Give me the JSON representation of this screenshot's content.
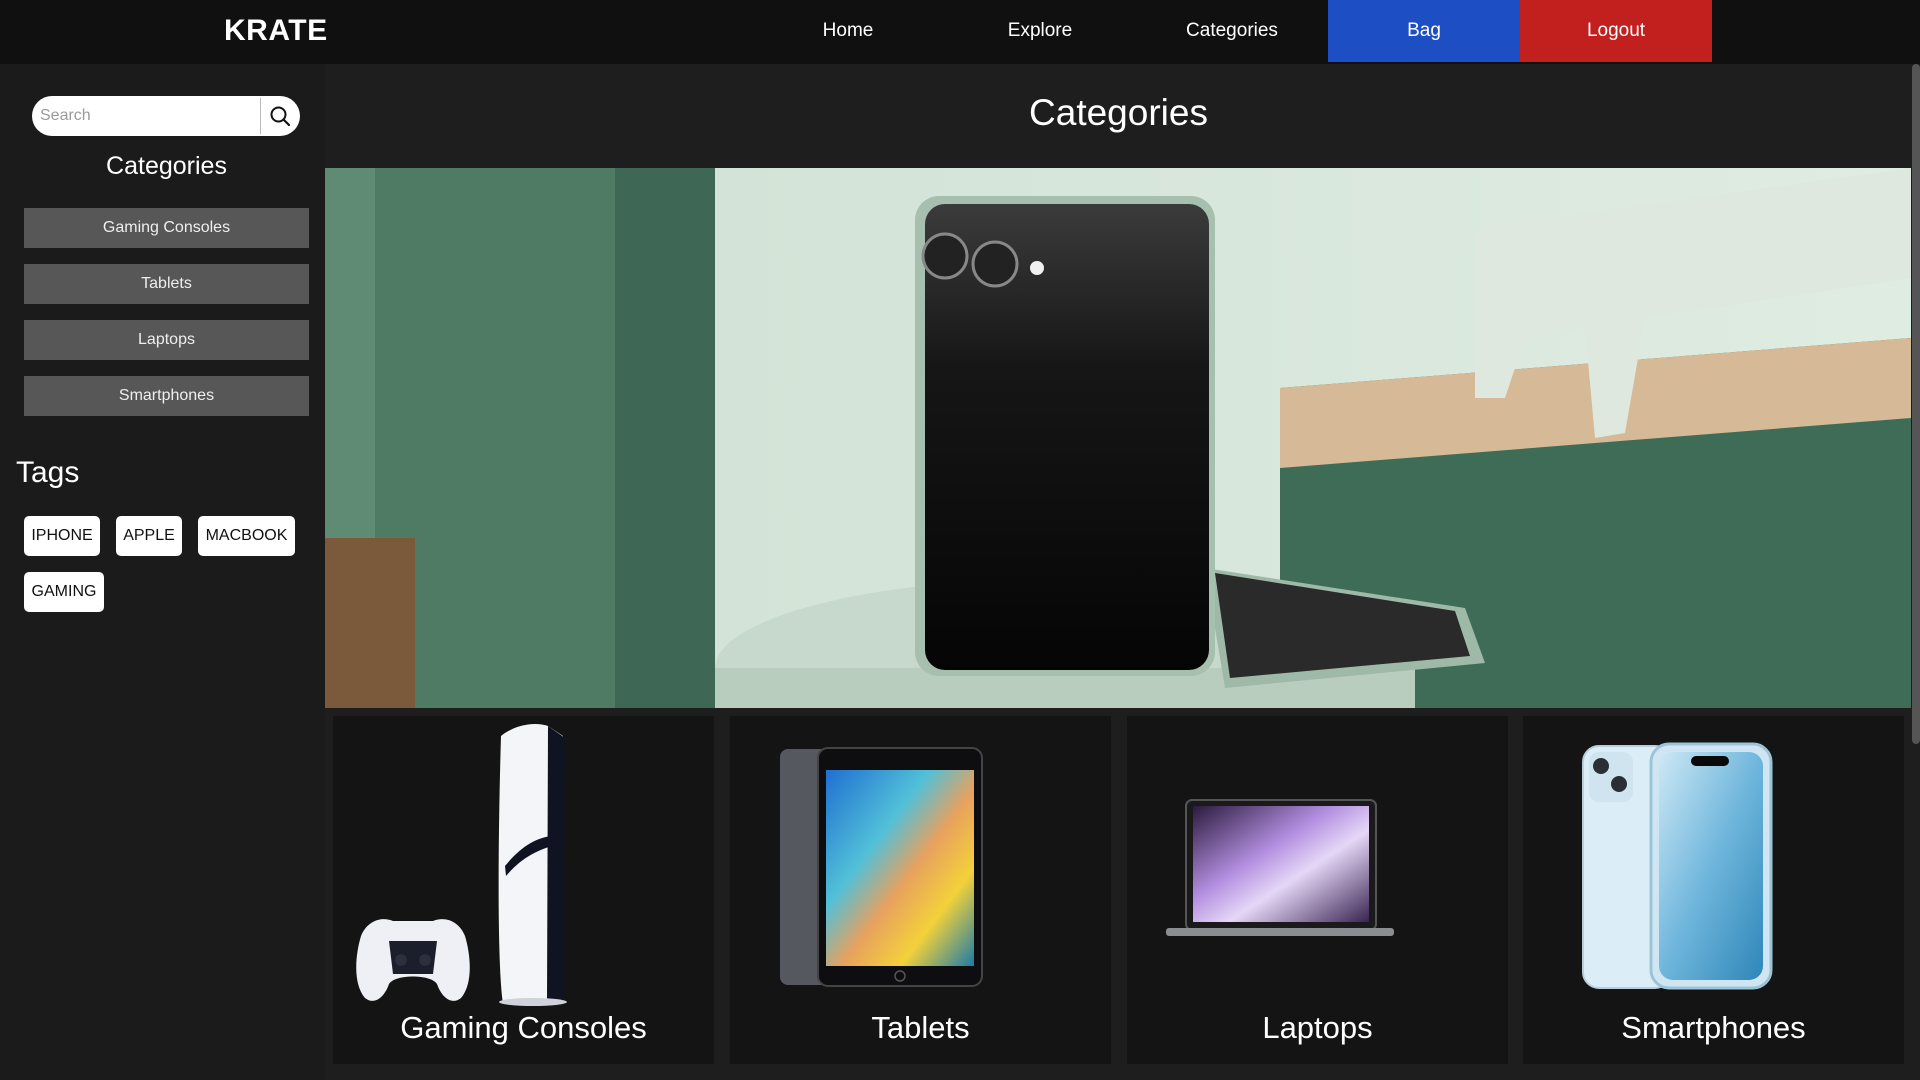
{
  "navbar": {
    "brand": "KRATE",
    "links": [
      "Home",
      "Explore",
      "Categories"
    ],
    "bag": "Bag",
    "logout": "Logout",
    "colors": {
      "bag": "#1d4ec4",
      "logout": "#c21f1f"
    }
  },
  "sidebar": {
    "search": {
      "placeholder": "Search",
      "value": "",
      "icon": "search-icon"
    },
    "categories_title": "Categories",
    "categories": [
      "Gaming Consoles",
      "Tablets",
      "Laptops",
      "Smartphones"
    ],
    "tags_title": "Tags",
    "tags": [
      "IPHONE",
      "APPLE",
      "MACBOOK",
      "GAMING"
    ]
  },
  "main": {
    "title": "Categories",
    "cards": [
      "Gaming Consoles",
      "Tablets",
      "Laptops",
      "Smartphones"
    ]
  }
}
